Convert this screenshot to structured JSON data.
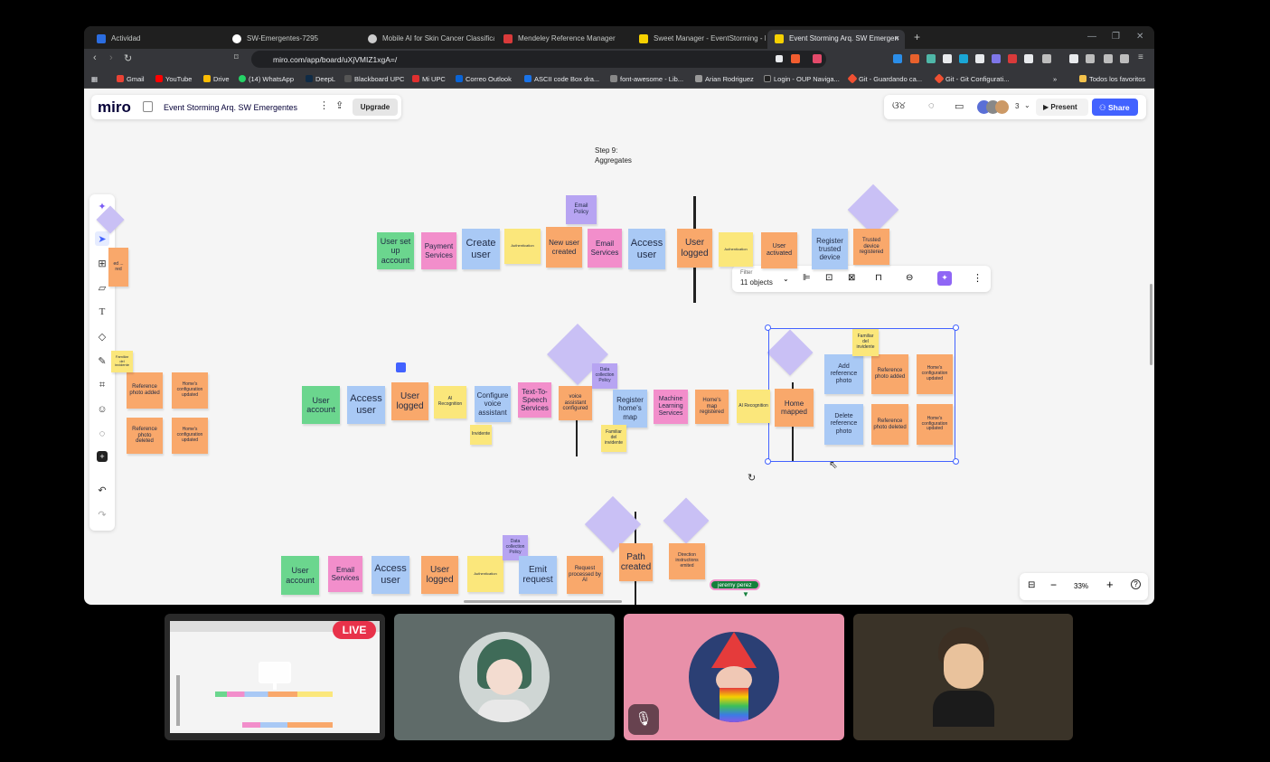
{
  "browser": {
    "tabs": [
      {
        "label": "Actividad",
        "color": "#2b6de0"
      },
      {
        "label": "SW-Emergentes-7295",
        "color": "#ffffff"
      },
      {
        "label": "Mobile AI for Skin Cancer Classificati",
        "color": "#cccccc"
      },
      {
        "label": "Mendeley Reference Manager",
        "color": "#d93a3a"
      },
      {
        "label": "Sweet Manager - EventStorming - M",
        "color": "#f5d000"
      },
      {
        "label": "Event Storming Arq. SW Emergen",
        "color": "#f5d000"
      }
    ],
    "tab_close": "×",
    "new_tab": "+",
    "url": "miro.com/app/board/uXjVMIZ1xgA=/",
    "bookmarks": [
      {
        "label": "Gmail",
        "color": "#ea4335"
      },
      {
        "label": "YouTube",
        "color": "#ff0000"
      },
      {
        "label": "Drive",
        "color": "#fbbc04"
      },
      {
        "label": "(14) WhatsApp",
        "color": "#25d366"
      },
      {
        "label": "DeepL",
        "color": "#0f2b46"
      },
      {
        "label": "Blackboard UPC",
        "color": "#2a2a2a"
      },
      {
        "label": "Mi UPC",
        "color": "#e03030"
      },
      {
        "label": "Correo Outlook",
        "color": "#0a64d6"
      },
      {
        "label": "ASCII code Box dra...",
        "color": "#1a73e8"
      },
      {
        "label": "font-awesome - Lib...",
        "color": "#888888"
      },
      {
        "label": "Arian Rodriguez",
        "color": "#999999"
      },
      {
        "label": "Login - OUP Naviga...",
        "color": "#222222"
      },
      {
        "label": "Git - Guardando ca...",
        "color": "#f05032"
      },
      {
        "label": "Git - Git Configurati...",
        "color": "#f05032"
      }
    ],
    "more_bookmarks": "»",
    "all_bookmarks": "Todos los favoritos"
  },
  "miro": {
    "logo": "miro",
    "board_title": "Event Storming Arq. SW Emergentes",
    "upgrade": "Upgrade",
    "collab_count": "3",
    "present": "Present",
    "share": "Share",
    "zoom": "33%",
    "step_title_1": "Step 9:",
    "step_title_2": "Aggregates",
    "filter_label": "Filter",
    "filter_value": "11 objects",
    "cursor_user": "jeremy perez"
  },
  "stickies": [
    {
      "t": "User set up account",
      "c": "g",
      "s": 9
    },
    {
      "t": "Payment Services",
      "c": "p",
      "s": 8
    },
    {
      "t": "Create user",
      "c": "b",
      "s": 11
    },
    {
      "t": "Authentication",
      "c": "y",
      "s": 4
    },
    {
      "t": "New user created",
      "c": "o",
      "s": 8
    },
    {
      "t": "Email Policy",
      "c": "v",
      "s": 6
    },
    {
      "t": "Email Services",
      "c": "p",
      "s": 8
    },
    {
      "t": "Access user",
      "c": "b",
      "s": 11
    },
    {
      "t": "User logged",
      "c": "o",
      "s": 10
    },
    {
      "t": "Authentication",
      "c": "y",
      "s": 4
    },
    {
      "t": "User activated",
      "c": "o",
      "s": 7
    },
    {
      "t": "Register trusted device",
      "c": "b",
      "s": 8
    },
    {
      "t": "Trusted device registered",
      "c": "o",
      "s": 6
    },
    {
      "t": "User account",
      "c": "g",
      "s": 9
    },
    {
      "t": "Access user",
      "c": "b",
      "s": 11
    },
    {
      "t": "User logged",
      "c": "o",
      "s": 10
    },
    {
      "t": "AI Recognition",
      "c": "y",
      "s": 5
    },
    {
      "t": "Configure voice assistant",
      "c": "b",
      "s": 8
    },
    {
      "t": "Text-To-Speech Services",
      "c": "p",
      "s": 8
    },
    {
      "t": "voice assistant configured",
      "c": "o",
      "s": 6
    },
    {
      "t": "Data collection Policy",
      "c": "v",
      "s": 5
    },
    {
      "t": "Register home's map",
      "c": "b",
      "s": 8
    },
    {
      "t": "Machine Learning Services",
      "c": "p",
      "s": 7
    },
    {
      "t": "Home's map registered",
      "c": "o",
      "s": 6
    },
    {
      "t": "AI Recognition",
      "c": "y",
      "s": 5
    },
    {
      "t": "Invidente",
      "c": "y",
      "s": 5
    },
    {
      "t": "Familiar del invidente",
      "c": "y",
      "s": 5
    },
    {
      "t": "Home mapped",
      "c": "o",
      "s": 8
    },
    {
      "t": "Add reference photo",
      "c": "b",
      "s": 7
    },
    {
      "t": "Reference photo added",
      "c": "o",
      "s": 6
    },
    {
      "t": "Home's configuration updated",
      "c": "o",
      "s": 5
    },
    {
      "t": "Delete reference photo",
      "c": "b",
      "s": 7
    },
    {
      "t": "Reference photo deleted",
      "c": "o",
      "s": 6
    },
    {
      "t": "Home's configuration updated",
      "c": "o",
      "s": 5
    },
    {
      "t": "Familiar del invidente",
      "c": "y",
      "s": 5
    },
    {
      "t": "Reference photo added",
      "c": "o",
      "s": 6
    },
    {
      "t": "Home's configuration updated",
      "c": "o",
      "s": 5
    },
    {
      "t": "Reference photo deleted",
      "c": "o",
      "s": 6
    },
    {
      "t": "Home's configuration updated",
      "c": "o",
      "s": 5
    },
    {
      "t": "User account",
      "c": "g",
      "s": 9
    },
    {
      "t": "Email Services",
      "c": "p",
      "s": 8
    },
    {
      "t": "Access user",
      "c": "b",
      "s": 11
    },
    {
      "t": "User logged",
      "c": "o",
      "s": 10
    },
    {
      "t": "Authentication",
      "c": "y",
      "s": 4
    },
    {
      "t": "Data collection Policy",
      "c": "v",
      "s": 5
    },
    {
      "t": "Emit request",
      "c": "b",
      "s": 10
    },
    {
      "t": "Request processed by AI",
      "c": "o",
      "s": 6
    },
    {
      "t": "Path created",
      "c": "o",
      "s": 10
    },
    {
      "t": "Direction instructions emited",
      "c": "o",
      "s": 5
    },
    {
      "t": "ed ... red",
      "c": "o",
      "s": 5
    },
    {
      "t": "Familiar del invidente",
      "c": "y",
      "s": 4
    }
  ],
  "meet": {
    "live": "LIVE"
  }
}
